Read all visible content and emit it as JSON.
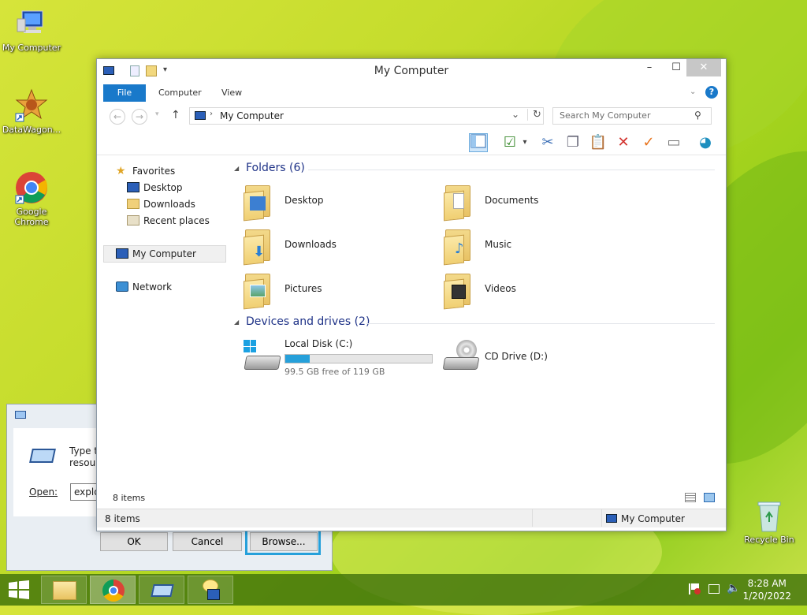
{
  "desktop": {
    "icons": [
      {
        "label": "My Computer"
      },
      {
        "label": "DataWagon..."
      },
      {
        "label": "Google Chrome"
      },
      {
        "label": "Recycle Bin"
      }
    ]
  },
  "run_dialog": {
    "description": "Type the name of a program, folder, document, or Internet resource",
    "description_visible_1": "Type the",
    "description_visible_2": "resource",
    "open_label": "Open:",
    "open_value": "explore",
    "ok_label": "OK",
    "cancel_label": "Cancel",
    "browse_label": "Browse..."
  },
  "explorer": {
    "title": "My Computer",
    "ribbon_tabs": [
      {
        "label": "File"
      },
      {
        "label": "Computer"
      },
      {
        "label": "View"
      }
    ],
    "address": "My Computer",
    "search_placeholder": "Search My Computer",
    "nav": {
      "favorites": "Favorites",
      "items": [
        {
          "label": "Desktop"
        },
        {
          "label": "Downloads"
        },
        {
          "label": "Recent places"
        }
      ],
      "my_computer": "My Computer",
      "network": "Network"
    },
    "groups": {
      "folders": "Folders (6)",
      "devices": "Devices and drives (2)"
    },
    "folders": [
      {
        "label": "Desktop"
      },
      {
        "label": "Documents"
      },
      {
        "label": "Downloads"
      },
      {
        "label": "Music"
      },
      {
        "label": "Pictures"
      },
      {
        "label": "Videos"
      }
    ],
    "drives": [
      {
        "label": "Local Disk (C:)",
        "free_text": "99.5 GB free of 119 GB",
        "used_fraction": 0.164
      },
      {
        "label": "CD Drive (D:)"
      }
    ],
    "item_count": "8 items",
    "status_count": "8 items",
    "status_location": "My Computer"
  },
  "taskbar": {
    "time": "8:28 AM",
    "date": "1/20/2022"
  },
  "colors": {
    "accent": "#1979ca",
    "progress": "#26a0da",
    "focus_ring": "#26a0da"
  }
}
